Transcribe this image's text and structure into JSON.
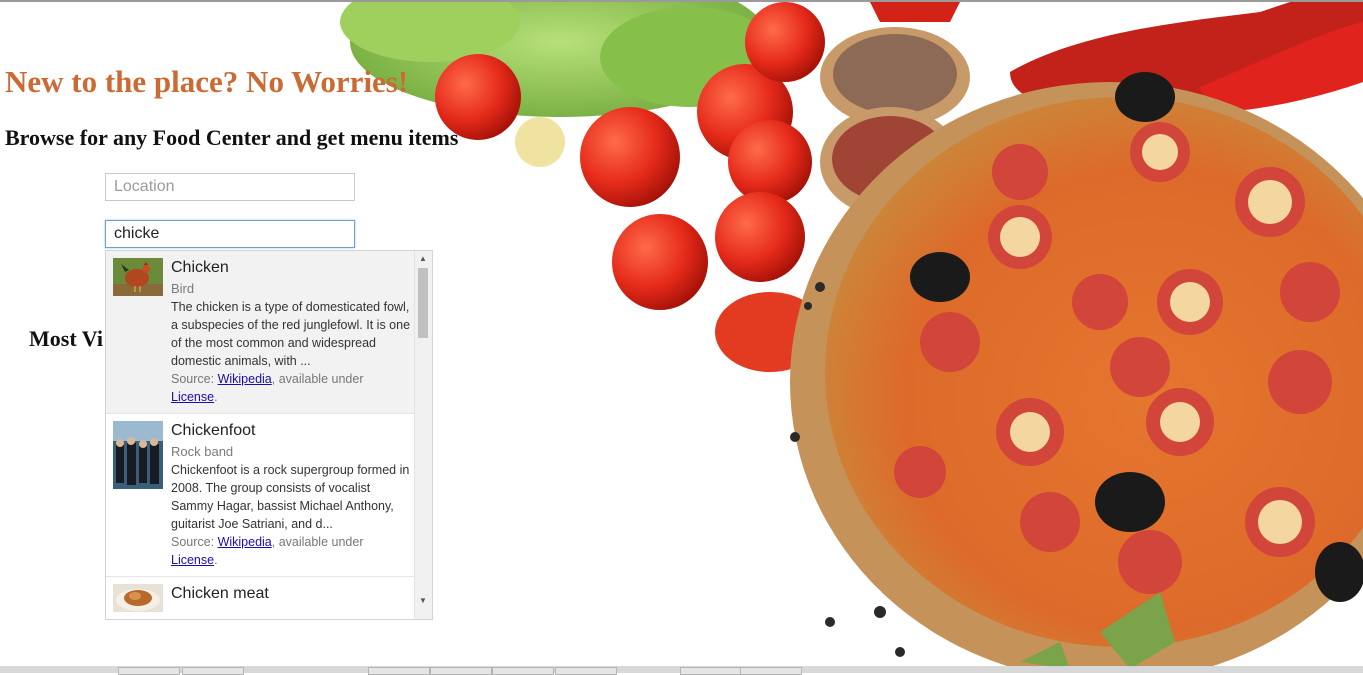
{
  "hero": {
    "title": "New to the place? No Worries!",
    "subtitle": "Browse for any Food Center and get menu items",
    "section_title": "Most Vi"
  },
  "search": {
    "location_placeholder": "Location",
    "location_value": "",
    "food_value": "chicke"
  },
  "suggestions": [
    {
      "title": "Chicken",
      "type": "Bird",
      "description": "The chicken is a type of domesticated fowl, a subspecies of the red junglefowl. It is one of the most common and widespread domestic animals, with ...",
      "source_prefix": "Source: ",
      "source_link": "Wikipedia",
      "source_middle": ", available under",
      "license_link": "License",
      "license_suffix": ".",
      "thumb_icon": "rooster-photo"
    },
    {
      "title": "Chickenfoot",
      "type": "Rock band",
      "description": "Chickenfoot is a rock supergroup formed in 2008. The group consists of vocalist Sammy Hagar, bassist Michael Anthony, guitarist Joe Satriani, and d...",
      "source_prefix": "Source: ",
      "source_link": "Wikipedia",
      "source_middle": ", available under",
      "license_link": "License",
      "license_suffix": ".",
      "thumb_icon": "band-photo"
    },
    {
      "title": "Chicken meat",
      "thumb_icon": "chicken-dish-photo"
    }
  ],
  "colors": {
    "hero_title": "#cc6a34",
    "link": "#1a0dab",
    "active_row": "#f2f2f2"
  },
  "icons": {
    "background": "pizza-and-vegetables-photo"
  }
}
